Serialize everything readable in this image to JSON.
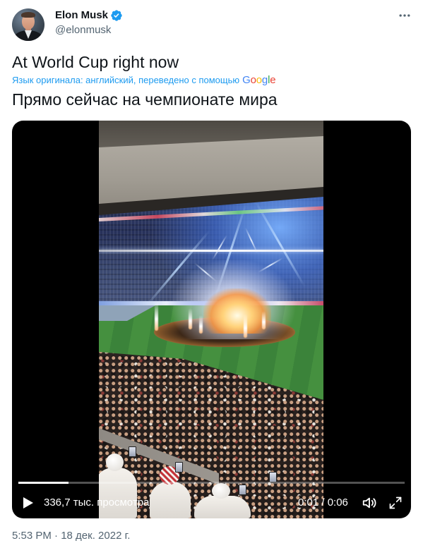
{
  "tweet": {
    "author": {
      "name": "Elon Musk",
      "handle": "@elonmusk",
      "verified": true
    },
    "text": "At World Cup right now",
    "translation": {
      "note": "Язык оригинала: английский, переведено с помощью",
      "provider": "Google",
      "text": "Прямо сейчас на чемпионате мира"
    },
    "media": {
      "views": "336,7 тыс. просмотра",
      "time": "0:01 / 0:06",
      "progress": 0.13,
      "playing": false
    },
    "timestamp": "5:53 PM · 18 дек. 2022 г."
  },
  "icons": {
    "verified": "verified-badge-icon",
    "more": "more-options-icon",
    "play": "play-icon",
    "volume": "volume-icon",
    "fullscreen": "fullscreen-icon"
  },
  "colors": {
    "text_primary": "#0f1419",
    "text_secondary": "#536471",
    "accent": "#1d9bf0",
    "video_background": "#000000",
    "progress_fill": "#ffffff",
    "google_logo": [
      "#4285F4",
      "#EA4335",
      "#FBBC05",
      "#4285F4",
      "#34A853",
      "#EA4335"
    ]
  }
}
